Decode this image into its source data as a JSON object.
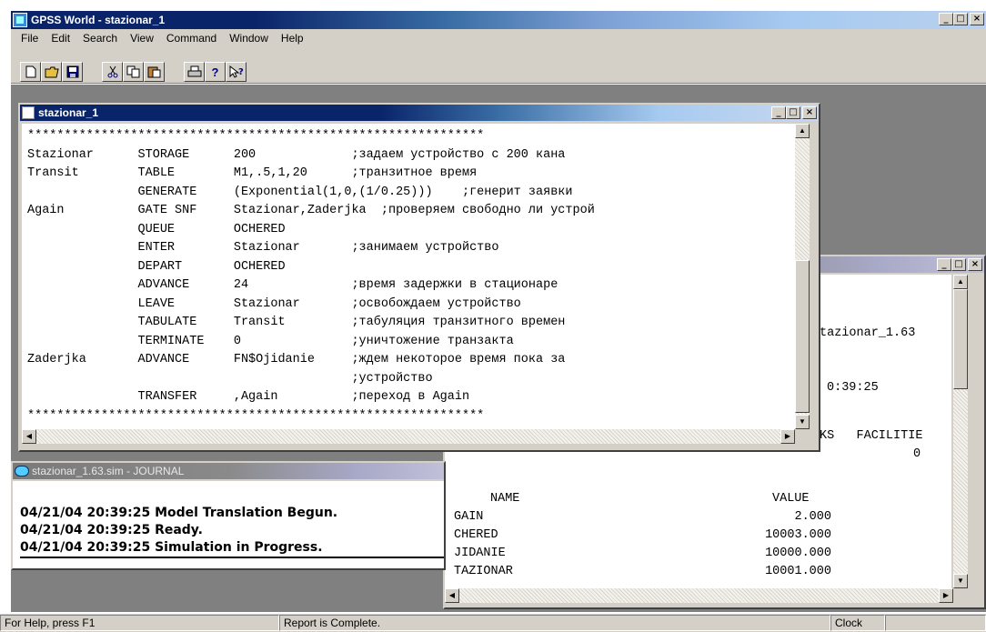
{
  "app": {
    "title": "GPSS World - stazionar_1"
  },
  "menu": [
    "File",
    "Edit",
    "Search",
    "View",
    "Command",
    "Window",
    "Help"
  ],
  "toolbar": {
    "icons": [
      "new-file-icon",
      "open-folder-icon",
      "save-icon",
      "cut-icon",
      "copy-icon",
      "paste-icon",
      "print-icon",
      "help-icon",
      "context-help-icon"
    ]
  },
  "editor": {
    "title": "stazionar_1",
    "lines": [
      "**************************************************************",
      "Stazionar      STORAGE      200             ;задаем устройство с 200 кана",
      "Transit        TABLE        M1,.5,1,20      ;транзитное время",
      "               GENERATE     (Exponential(1,0,(1/0.25)))    ;генерит заявки",
      "Again          GATE SNF     Stazionar,Zaderjka  ;проверяем свободно ли устрой",
      "               QUEUE        OCHERED",
      "               ENTER        Stazionar       ;занимаем устройство",
      "               DEPART       OCHERED",
      "               ADVANCE      24              ;время задержки в стационаре",
      "               LEAVE        Stazionar       ;освобождаем устройство",
      "               TABULATE     Transit         ;табуляция транзитного времен",
      "               TERMINATE    0               ;уничтожение транзакта",
      "Zaderjka       ADVANCE      FN$Ojidanie     ;ждем некоторое время пока за",
      "                                            ;устройство",
      "               TRANSFER     ,Again          ;переход в Again",
      "**************************************************************"
    ]
  },
  "report": {
    "visible_fragments": {
      "filename": "tazionar_1.63",
      "time": "0:39:25",
      "header_tail": "KS   FACILITIE",
      "value_tail": "0"
    },
    "table": {
      "headers": [
        "NAME",
        "VALUE"
      ],
      "rows": [
        {
          "name": "GAIN",
          "value": "2.000"
        },
        {
          "name": "CHERED",
          "value": "10003.000"
        },
        {
          "name": "JIDANIE",
          "value": "10000.000"
        },
        {
          "name": "TAZIONAR",
          "value": "10001.000"
        }
      ]
    }
  },
  "journal": {
    "title": "stazionar_1.63.sim - JOURNAL",
    "lines": [
      "04/21/04 20:39:25  Model Translation Begun.",
      "04/21/04 20:39:25  Ready.",
      "04/21/04 20:39:25  Simulation in Progress."
    ]
  },
  "status": {
    "help": "For Help, press F1",
    "message": "Report is Complete.",
    "clock": "Clock"
  }
}
